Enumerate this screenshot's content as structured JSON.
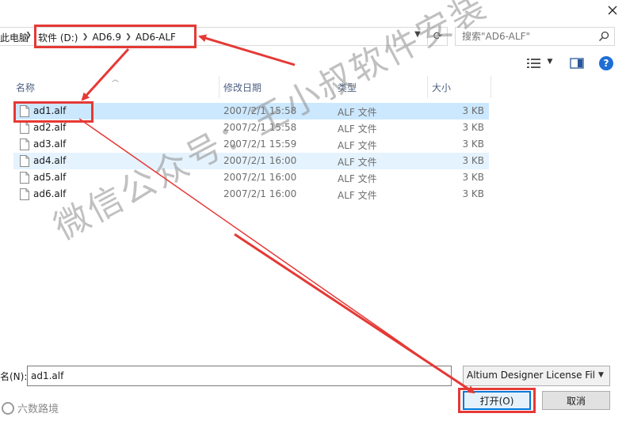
{
  "window": {
    "close_label": "✕"
  },
  "address": {
    "pc_label": "此电脑",
    "crumbs": [
      "软件 (D:)",
      "AD6.9",
      "AD6-ALF"
    ]
  },
  "search": {
    "placeholder": "搜索\"AD6-ALF\""
  },
  "columns": {
    "name": "名称",
    "date": "修改日期",
    "type": "类型",
    "size": "大小"
  },
  "files": [
    {
      "name": "ad1.alf",
      "date": "2007/2/1 15:58",
      "type": "ALF 文件",
      "size": "3 KB",
      "state": "selected"
    },
    {
      "name": "ad2.alf",
      "date": "2007/2/1 15:58",
      "type": "ALF 文件",
      "size": "3 KB",
      "state": ""
    },
    {
      "name": "ad3.alf",
      "date": "2007/2/1 15:59",
      "type": "ALF 文件",
      "size": "3 KB",
      "state": ""
    },
    {
      "name": "ad4.alf",
      "date": "2007/2/1 16:00",
      "type": "ALF 文件",
      "size": "3 KB",
      "state": "hover"
    },
    {
      "name": "ad5.alf",
      "date": "2007/2/1 16:00",
      "type": "ALF 文件",
      "size": "3 KB",
      "state": ""
    },
    {
      "name": "ad6.alf",
      "date": "2007/2/1 16:00",
      "type": "ALF 文件",
      "size": "3 KB",
      "state": ""
    }
  ],
  "filename": {
    "label": "名(N):",
    "value": "ad1.alf"
  },
  "filter": {
    "value": "Altium Designer License Files"
  },
  "buttons": {
    "open": "打开(O)",
    "cancel": "取消"
  },
  "watermark": {
    "text": "微信公众号：王小叔软件安装"
  },
  "logo": {
    "text": "六数路境"
  },
  "icons": {
    "close": "close-icon",
    "search": "search-icon",
    "refresh": "refresh-icon",
    "help": "help-icon",
    "view": "view-list-icon",
    "pane": "preview-pane-icon",
    "file": "file-icon"
  },
  "colors": {
    "selected_row": "#cce8ff",
    "hover_row": "#e5f3ff",
    "annotation": "#e53935",
    "accent": "#0078d7",
    "header_text": "#4d6082"
  }
}
